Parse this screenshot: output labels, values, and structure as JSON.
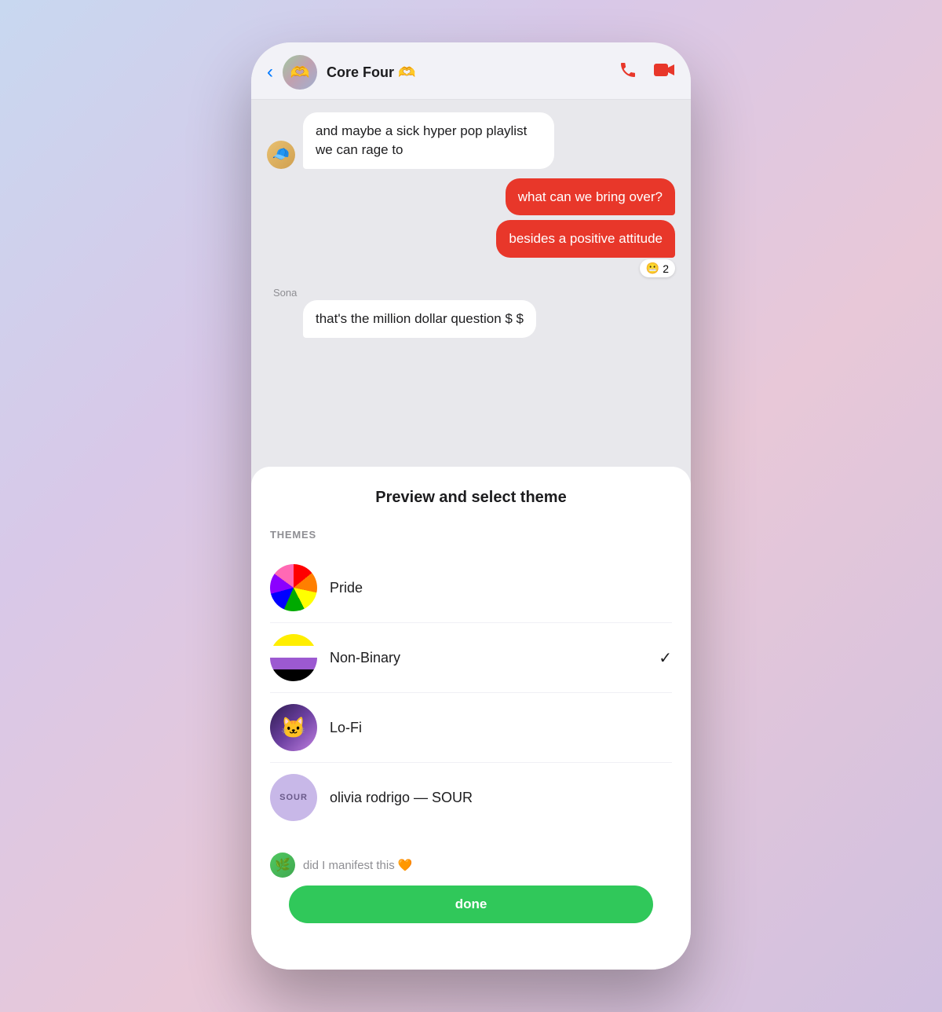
{
  "header": {
    "back_icon": "‹",
    "group_name": "Core Four 🫶",
    "group_emoji": "🫶",
    "call_icon": "📞",
    "video_icon": "📹"
  },
  "messages": [
    {
      "id": "msg1",
      "type": "incoming",
      "avatar_emoji": "🧢",
      "text": "and maybe a sick hyper pop playlist we can rage to"
    },
    {
      "id": "msg2",
      "type": "outgoing",
      "bubbles": [
        "what can we bring over?",
        "besides a positive attitude"
      ],
      "reaction": "😬",
      "reaction_count": "2"
    },
    {
      "id": "msg3",
      "type": "incoming",
      "sender_name": "Sona",
      "text": "that's the million dollar question $ $"
    }
  ],
  "bottom_sheet": {
    "title": "Preview and select theme",
    "section_label": "THEMES",
    "themes": [
      {
        "id": "pride",
        "name": "Pride",
        "icon_type": "pride",
        "selected": false
      },
      {
        "id": "non-binary",
        "name": "Non-Binary",
        "icon_type": "nonbinary",
        "selected": true,
        "check": "✓"
      },
      {
        "id": "lofi",
        "name": "Lo-Fi",
        "icon_type": "lofi",
        "icon_emoji": "🐱",
        "selected": false
      },
      {
        "id": "sour",
        "name": "olivia rodrigo — SOUR",
        "icon_type": "sour",
        "icon_text": "SOUR",
        "selected": false
      }
    ]
  },
  "partial_message_text": "did I manifest this 🧡",
  "green_button_label": "done"
}
